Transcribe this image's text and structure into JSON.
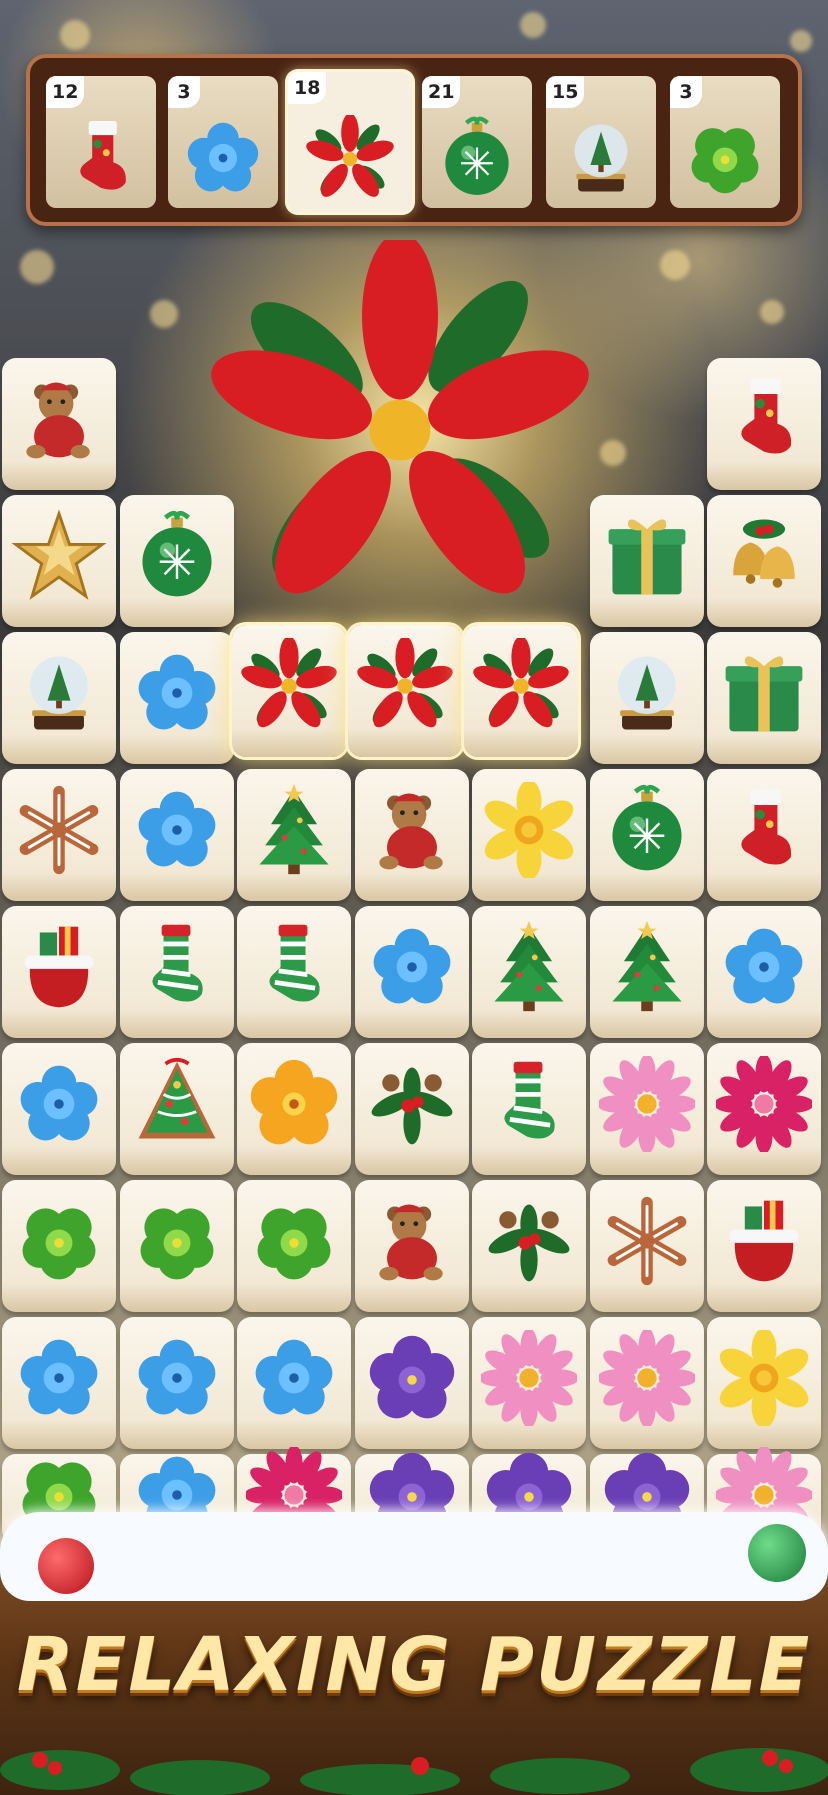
{
  "tray": {
    "slots": [
      {
        "count": "12",
        "icon": "stocking-icon"
      },
      {
        "count": "3",
        "icon": "blue-flower-icon"
      },
      {
        "count": "18",
        "icon": "poinsettia-icon",
        "selected": true
      },
      {
        "count": "21",
        "icon": "green-ornament-icon"
      },
      {
        "count": "15",
        "icon": "snow-globe-icon"
      },
      {
        "count": "3",
        "icon": "green-pansy-icon"
      }
    ]
  },
  "featured_icon": "poinsettia-icon",
  "board": {
    "rows": [
      [
        "teddy-bear-icon",
        null,
        null,
        null,
        null,
        null,
        "stocking-icon"
      ],
      [
        "gold-star-icon",
        "green-ornament-icon",
        null,
        null,
        null,
        "gift-box-icon",
        "bells-icon"
      ],
      [
        "snow-globe-icon",
        "blue-flower-icon",
        "poinsettia-icon",
        "poinsettia-icon",
        "poinsettia-icon",
        "snow-globe-icon",
        "gift-box-icon"
      ],
      [
        "gingerbread-snowflake-icon",
        "blue-flower-icon",
        "christmas-tree-icon",
        "teddy-bear-icon",
        "daffodil-icon",
        "green-ornament-icon",
        "stocking-icon"
      ],
      [
        "santa-sack-icon",
        "striped-stocking-icon",
        "striped-stocking-icon",
        "blue-flower-icon",
        "christmas-tree-icon",
        "christmas-tree-icon",
        "blue-flower-icon"
      ],
      [
        "blue-flower-icon",
        "gingerbread-tree-icon",
        "yellow-flower-icon",
        "holly-wreath-icon",
        "striped-stocking-icon",
        "pink-dahlia-icon",
        "magenta-dahlia-icon"
      ],
      [
        "green-pansy-icon",
        "green-pansy-icon",
        "green-pansy-icon",
        "teddy-bear-icon",
        "holly-wreath-icon",
        "gingerbread-snowflake-icon",
        "santa-sack-icon"
      ],
      [
        "blue-flower-icon",
        "blue-flower-icon",
        "blue-flower-icon",
        "purple-violet-icon",
        "pink-dahlia-icon",
        "pink-dahlia-icon",
        "daffodil-icon"
      ],
      [
        "green-pansy-icon",
        "blue-flower-icon",
        "magenta-dahlia-icon",
        "purple-violet-icon",
        "purple-violet-icon",
        "purple-violet-icon",
        "pink-dahlia-icon"
      ]
    ],
    "highlighted_row": 2,
    "highlighted_cols": [
      2,
      3,
      4
    ]
  },
  "banner": {
    "title": "RELAXING PUZZLE"
  },
  "colors": {
    "tray_bg": "#4a2413",
    "tray_border": "#b8724a",
    "tile_face": "#fbf6ec",
    "title_gold": "#ffe7a8"
  }
}
